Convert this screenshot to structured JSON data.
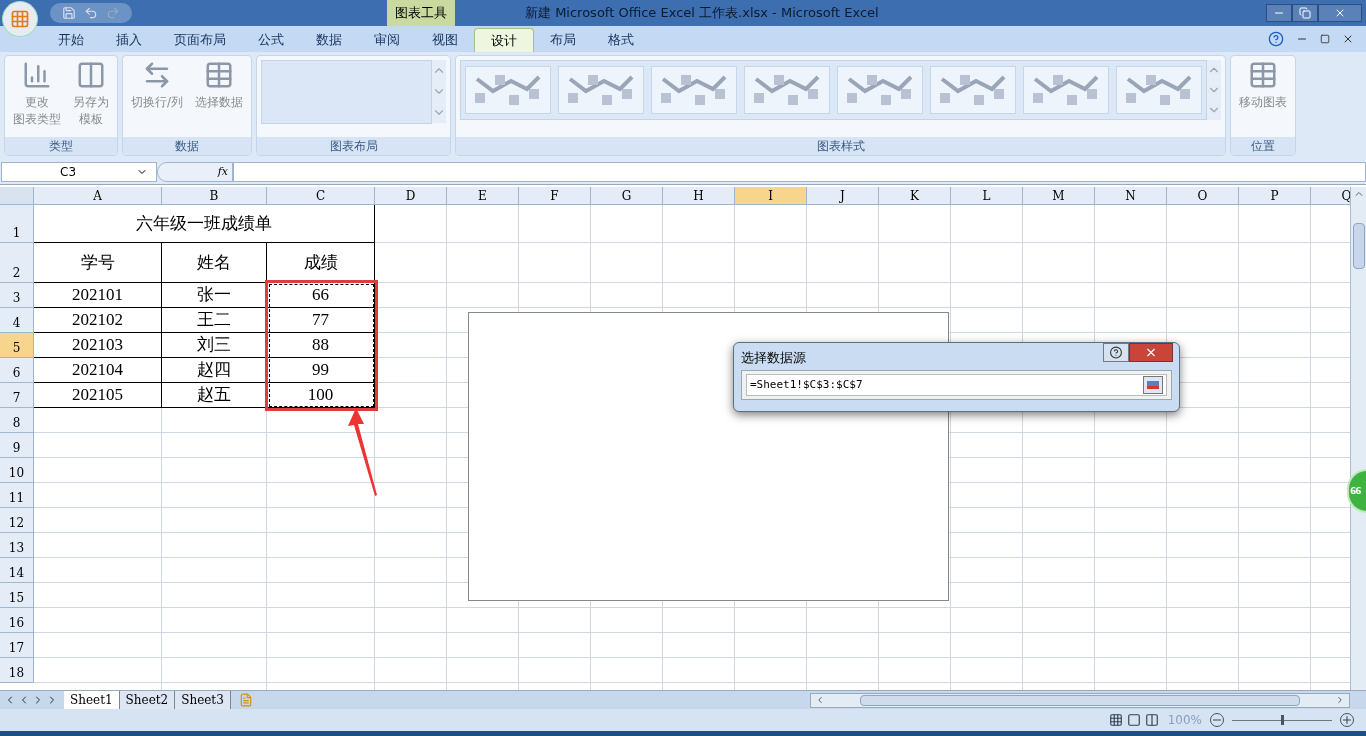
{
  "window": {
    "title": "新建 Microsoft Office Excel 工作表.xlsx - Microsoft Excel",
    "context_group": "图表工具"
  },
  "ribbon": {
    "tabs": [
      {
        "label": "开始",
        "selected": false
      },
      {
        "label": "插入",
        "selected": false
      },
      {
        "label": "页面布局",
        "selected": false
      },
      {
        "label": "公式",
        "selected": false
      },
      {
        "label": "数据",
        "selected": false
      },
      {
        "label": "审阅",
        "selected": false
      },
      {
        "label": "视图",
        "selected": false
      },
      {
        "label": "设计",
        "selected": true
      },
      {
        "label": "布局",
        "selected": false
      },
      {
        "label": "格式",
        "selected": false
      }
    ],
    "groups": [
      {
        "label": "类型",
        "kind": "buttons",
        "buttons": [
          {
            "lines": [
              "更改",
              "图表类型"
            ]
          },
          {
            "lines": [
              "另存为",
              "模板"
            ]
          }
        ]
      },
      {
        "label": "数据",
        "kind": "buttons",
        "buttons": [
          {
            "lines": [
              "切换行/列"
            ]
          },
          {
            "lines": [
              "选择数据"
            ]
          }
        ]
      },
      {
        "label": "图表布局",
        "kind": "layout_gallery"
      },
      {
        "label": "图表样式",
        "kind": "style_gallery"
      },
      {
        "label": "位置",
        "kind": "buttons",
        "buttons": [
          {
            "lines": [
              "移动图表"
            ]
          }
        ]
      }
    ]
  },
  "formula_bar": {
    "name_box": "C3",
    "function_label": "fx"
  },
  "sheet": {
    "columns": [
      {
        "label": "A",
        "selected": false
      },
      {
        "label": "B",
        "selected": false
      },
      {
        "label": "C",
        "selected": false
      },
      {
        "label": "D",
        "selected": false
      },
      {
        "label": "E",
        "selected": false
      },
      {
        "label": "F",
        "selected": false
      },
      {
        "label": "G",
        "selected": false
      },
      {
        "label": "H",
        "selected": false
      },
      {
        "label": "I",
        "selected": true
      },
      {
        "label": "J",
        "selected": false
      },
      {
        "label": "K",
        "selected": false
      },
      {
        "label": "L",
        "selected": false
      },
      {
        "label": "M",
        "selected": false
      },
      {
        "label": "N",
        "selected": false
      },
      {
        "label": "O",
        "selected": false
      },
      {
        "label": "P",
        "selected": false
      },
      {
        "label": "Q",
        "selected": false
      }
    ],
    "rows": [
      {
        "header": "1",
        "selected": false,
        "kind": "title",
        "cells": [
          "六年级一班成绩单"
        ]
      },
      {
        "header": "2",
        "selected": false,
        "kind": "data",
        "cells": [
          "学号",
          "姓名",
          "成绩"
        ]
      },
      {
        "header": "3",
        "selected": false,
        "kind": "data",
        "cells": [
          "202101",
          "张一",
          "66"
        ]
      },
      {
        "header": "4",
        "selected": false,
        "kind": "data",
        "cells": [
          "202102",
          "王二",
          "77"
        ]
      },
      {
        "header": "5",
        "selected": true,
        "kind": "data",
        "cells": [
          "202103",
          "刘三",
          "88"
        ]
      },
      {
        "header": "6",
        "selected": false,
        "kind": "data",
        "cells": [
          "202104",
          "赵四",
          "99"
        ]
      },
      {
        "header": "7",
        "selected": false,
        "kind": "data",
        "cells": [
          "202105",
          "赵五",
          "100"
        ]
      },
      {
        "header": "8",
        "selected": false,
        "kind": "empty"
      },
      {
        "header": "9",
        "selected": false,
        "kind": "empty"
      },
      {
        "header": "10",
        "selected": false,
        "kind": "empty"
      },
      {
        "header": "11",
        "selected": false,
        "kind": "empty"
      },
      {
        "header": "12",
        "selected": false,
        "kind": "empty"
      },
      {
        "header": "13",
        "selected": false,
        "kind": "empty"
      },
      {
        "header": "14",
        "selected": false,
        "kind": "empty"
      },
      {
        "header": "15",
        "selected": false,
        "kind": "empty"
      },
      {
        "header": "16",
        "selected": false,
        "kind": "empty"
      },
      {
        "header": "17",
        "selected": false,
        "kind": "empty"
      },
      {
        "header": "18",
        "selected": false,
        "kind": "empty"
      }
    ]
  },
  "dialog": {
    "title": "选择数据源",
    "value": "=Sheet1!$C$3:$C$7"
  },
  "badge": "66",
  "sheet_tabs": [
    {
      "label": "Sheet1",
      "selected": true
    },
    {
      "label": "Sheet2",
      "selected": false
    },
    {
      "label": "Sheet3",
      "selected": false
    }
  ],
  "status_bar": {
    "zoom": "100%",
    "level": 0.5
  }
}
